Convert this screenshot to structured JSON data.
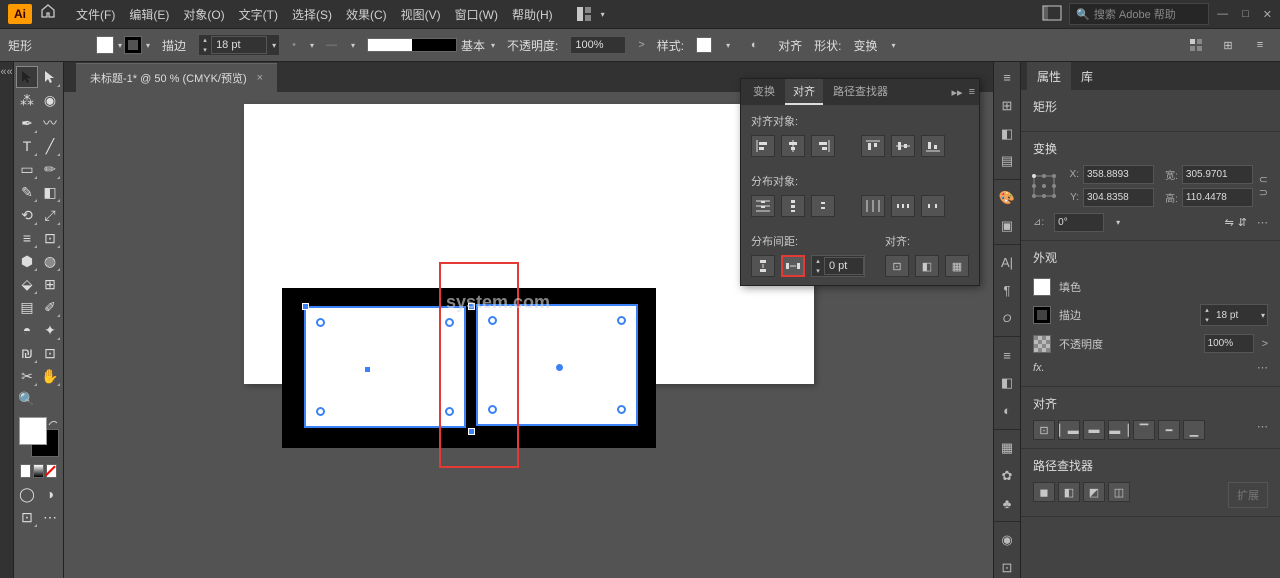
{
  "topbar": {
    "menus": [
      "文件(F)",
      "编辑(E)",
      "对象(O)",
      "文字(T)",
      "选择(S)",
      "效果(C)",
      "视图(V)",
      "窗口(W)",
      "帮助(H)"
    ],
    "search_placeholder": "搜索 Adobe 帮助"
  },
  "controlbar": {
    "shape_label": "矩形",
    "stroke_label": "描边",
    "stroke_value": "18 pt",
    "style_label": "基本",
    "opacity_label": "不透明度:",
    "opacity_value": "100%",
    "graphic_style": "样式:",
    "align_label": "对齐",
    "shape_menu": "形状:",
    "transform_label": "变换"
  },
  "tab": {
    "title": "未标题-1* @ 50 % (CMYK/预览)"
  },
  "align_panel": {
    "tabs": [
      "变换",
      "对齐",
      "路径查找器"
    ],
    "active": 1,
    "section1": "对齐对象:",
    "section2": "分布对象:",
    "section3": "分布间距:",
    "section3b": "对齐:",
    "spacing_value": "0 pt"
  },
  "props": {
    "tabs": [
      "属性",
      "库"
    ],
    "shape_type": "矩形",
    "transform_heading": "变换",
    "x": "358.8893",
    "y": "304.8358",
    "w": "305.9701",
    "h": "110.4478",
    "x_label": "X:",
    "y_label": "Y:",
    "w_label": "宽:",
    "h_label": "高:",
    "angle_label": "⊿:",
    "angle": "0°",
    "appearance_heading": "外观",
    "fill_label": "填色",
    "stroke_label": "描边",
    "stroke_val": "18 pt",
    "opacity_label": "不透明度",
    "opacity_val": "100%",
    "fx": "fx.",
    "align_heading": "对齐",
    "pathfinder_heading": "路径查找器",
    "expand": "扩展"
  },
  "watermark": "system.com"
}
